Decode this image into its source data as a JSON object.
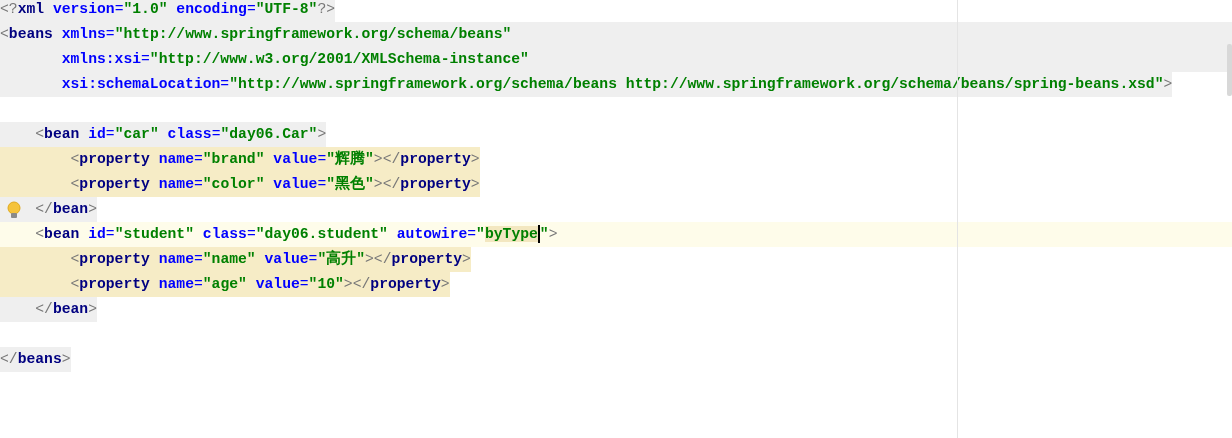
{
  "editor": {
    "lines": [
      {
        "text": "<?xml version=\"1.0\" encoding=\"UTF-8\"?>",
        "kind": "tag",
        "current": false,
        "hint": false
      },
      {
        "text": "<beans xmlns=\"http://www.springframework.org/schema/beans\"",
        "kind": "wide",
        "current": false,
        "hint": false
      },
      {
        "text": "       xmlns:xsi=\"http://www.w3.org/2001/XMLSchema-instance\"",
        "kind": "wide",
        "current": false,
        "hint": false
      },
      {
        "text": "       xsi:schemaLocation=\"http://www.springframework.org/schema/beans http://www.springframework.org/schema/beans/spring-beans.xsd\">",
        "kind": "tag",
        "current": false,
        "hint": false
      },
      {
        "kind": "blank",
        "current": false,
        "hint": false
      },
      {
        "text": "    <bean id=\"car\" class=\"day06.Car\">",
        "kind": "tag",
        "current": false,
        "hint": false
      },
      {
        "text": "        <property name=\"brand\" value=\"辉腾\"></property>",
        "kind": "property",
        "current": false,
        "hint": false
      },
      {
        "text": "        <property name=\"color\" value=\"黑色\"></property>",
        "kind": "property",
        "current": false,
        "hint": false
      },
      {
        "text": "    </bean>",
        "kind": "tag",
        "current": false,
        "hint": true
      },
      {
        "parts": [
          {
            "text": "    <bean id=\"student\" class=\"day06.student\" autowire=\"",
            "kind": "plain"
          },
          {
            "text": "byType",
            "kind": "match",
            "caret": true
          },
          {
            "text": "\">",
            "kind": "plain"
          }
        ],
        "kind": "plain",
        "current": true,
        "hint": false
      },
      {
        "text": "        <property name=\"name\" value=\"高升\"></property>",
        "kind": "property",
        "current": false,
        "hint": false
      },
      {
        "text": "        <property name=\"age\" value=\"10\"></property>",
        "kind": "property",
        "current": false,
        "hint": false
      },
      {
        "text": "    </bean>",
        "kind": "tag",
        "current": false,
        "hint": false
      },
      {
        "kind": "blank",
        "current": false,
        "hint": false
      },
      {
        "text": "</beans>",
        "kind": "tag",
        "current": false,
        "hint": false
      }
    ]
  }
}
